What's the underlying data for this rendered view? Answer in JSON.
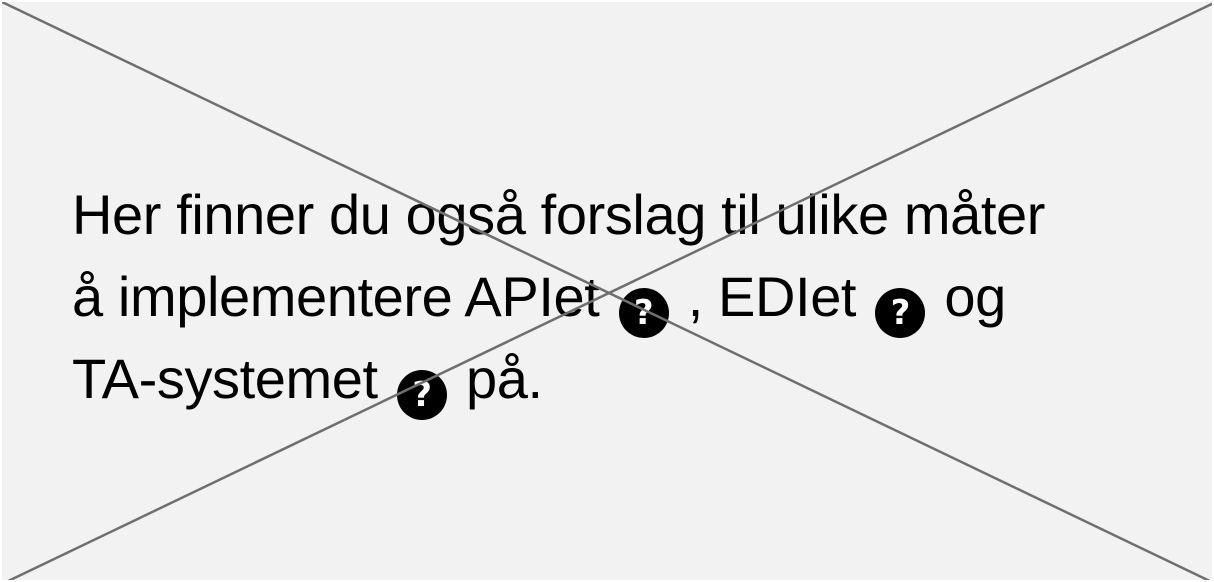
{
  "colors": {
    "background": "#f2f2f2",
    "cross_line": "#6f6f6f",
    "text": "#000000",
    "help_icon_bg": "#000000",
    "help_icon_fg": "#ffffff"
  },
  "icons": {
    "help": {
      "name": "question-circle-icon",
      "glyph": "?"
    }
  },
  "content": {
    "line_1": "Her finner du også forslag til ulike måter",
    "line_2_prefix": "å implementere APIet ",
    "line_2_mid": " , EDIet ",
    "line_2_suffix": " og",
    "line_3_prefix": "TA-systemet ",
    "line_3_suffix": " på."
  }
}
